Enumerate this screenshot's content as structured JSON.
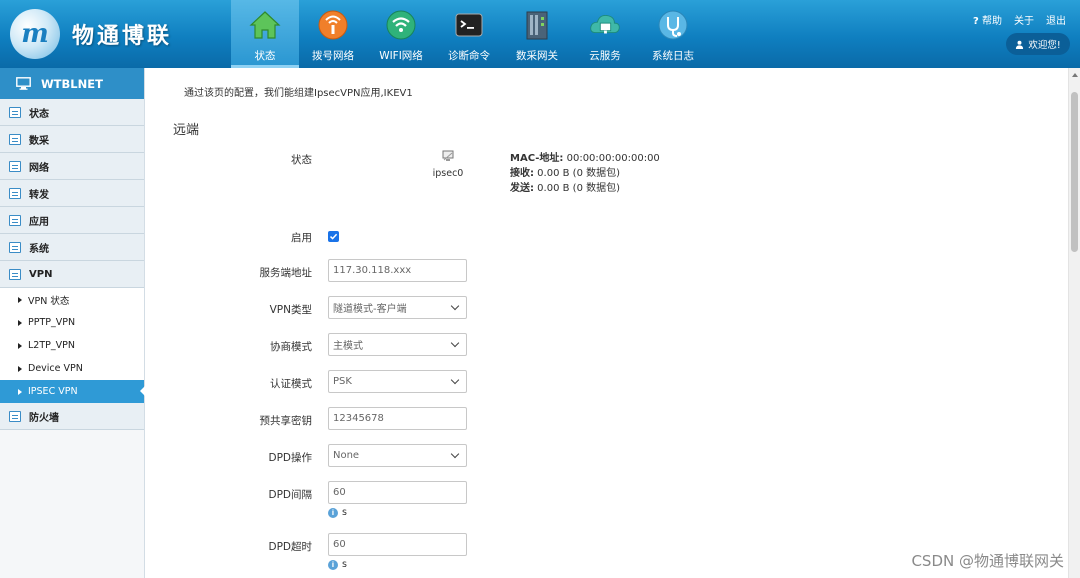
{
  "header": {
    "logo_mark": "m",
    "brand": "物通博联",
    "nav": [
      {
        "label": "状态",
        "icon": "home-icon"
      },
      {
        "label": "拨号网络",
        "icon": "dial-network-icon"
      },
      {
        "label": "WIFI网络",
        "icon": "wifi-icon"
      },
      {
        "label": "诊断命令",
        "icon": "terminal-icon"
      },
      {
        "label": "数采网关",
        "icon": "gateway-icon"
      },
      {
        "label": "云服务",
        "icon": "cloud-icon"
      },
      {
        "label": "系统日志",
        "icon": "stethoscope-icon"
      }
    ],
    "active_nav": "状态",
    "links": {
      "help": "帮助",
      "about": "关于",
      "logout": "退出"
    },
    "help_mark": "?",
    "welcome": "欢迎您!"
  },
  "sidebar": {
    "title": "WTBLNET",
    "sections": [
      {
        "label": "状态"
      },
      {
        "label": "数采"
      },
      {
        "label": "网络"
      },
      {
        "label": "转发"
      },
      {
        "label": "应用"
      },
      {
        "label": "系统"
      },
      {
        "label": "VPN"
      }
    ],
    "vpn_items": [
      {
        "label": "VPN 状态"
      },
      {
        "label": "PPTP_VPN"
      },
      {
        "label": "L2TP_VPN"
      },
      {
        "label": "Device VPN"
      },
      {
        "label": "IPSEC VPN"
      }
    ],
    "active_item": "IPSEC VPN",
    "last_section": "防火墙"
  },
  "main": {
    "intro": "通过该页的配置，我们能组建IpsecVPN应用,IKEV1",
    "section_title": "远端",
    "status": {
      "label": "状态",
      "device": "ipsec0",
      "mac_label": "MAC-地址:",
      "mac_value": " 00:00:00:00:00:00",
      "rx_label": "接收:",
      "rx_value": " 0.00 B (0 数据包)",
      "tx_label": "发送:",
      "tx_value": " 0.00 B (0 数据包)"
    },
    "form": {
      "enable_label": "启用",
      "enable_checked": true,
      "server_label": "服务端地址",
      "server_value": "117.30.118.xxx",
      "vpn_type_label": "VPN类型",
      "vpn_type_value": "隧道模式-客户端",
      "negotiation_label": "协商模式",
      "negotiation_value": "主模式",
      "auth_label": "认证模式",
      "auth_value": "PSK",
      "psk_label": "预共享密钥",
      "psk_value": "12345678",
      "dpd_action_label": "DPD操作",
      "dpd_action_value": "None",
      "dpd_interval_label": "DPD间隔",
      "dpd_interval_value": "60",
      "dpd_interval_unit": "s",
      "dpd_timeout_label": "DPD超时",
      "dpd_timeout_value": "60",
      "dpd_timeout_unit": "s",
      "unit_icon_mark": "i"
    }
  },
  "watermark": "CSDN @物通博联网关",
  "colors": {
    "header_blue": "#0f7fc0",
    "sidebar_active": "#2f9ad6",
    "checkbox": "#1a73e8"
  }
}
